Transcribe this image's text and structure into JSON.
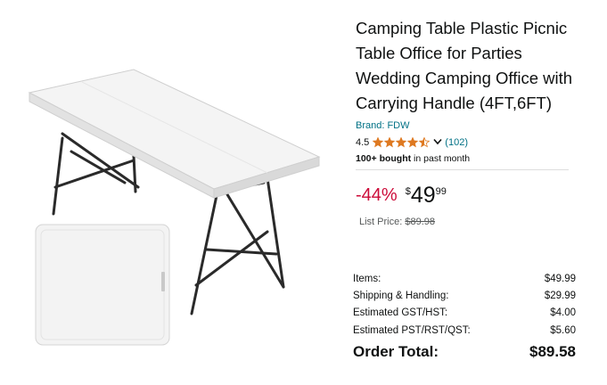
{
  "product": {
    "title": "Camping Table Plastic Picnic Table Office for Parties Wedding Camping Office with Carrying Handle (4FT,6FT)",
    "brand": "Brand: FDW",
    "rating": "4.5",
    "rating_value": 4.5,
    "review_count": "(102)",
    "bought_bold": "100+ bought",
    "bought_rest": " in past month",
    "discount": "-44%",
    "price_currency": "$",
    "price_whole": "49",
    "price_fraction": "99",
    "list_price_label": "List Price: ",
    "list_price": "$89.98",
    "icons": {
      "stars": "star-rating-icon",
      "chevron": "chevron-down-icon"
    }
  },
  "summary": {
    "rows": [
      {
        "label": "Items:",
        "value": "$49.99"
      },
      {
        "label": "Shipping & Handling:",
        "value": "$29.99"
      },
      {
        "label": "Estimated GST/HST:",
        "value": "$4.00"
      },
      {
        "label": "Estimated PST/RST/QST:",
        "value": "$5.60"
      }
    ],
    "total_label": "Order Total:",
    "total_value": "$89.58"
  },
  "colors": {
    "star": "#de7921",
    "link": "#007185",
    "discount": "#cc0c39"
  }
}
